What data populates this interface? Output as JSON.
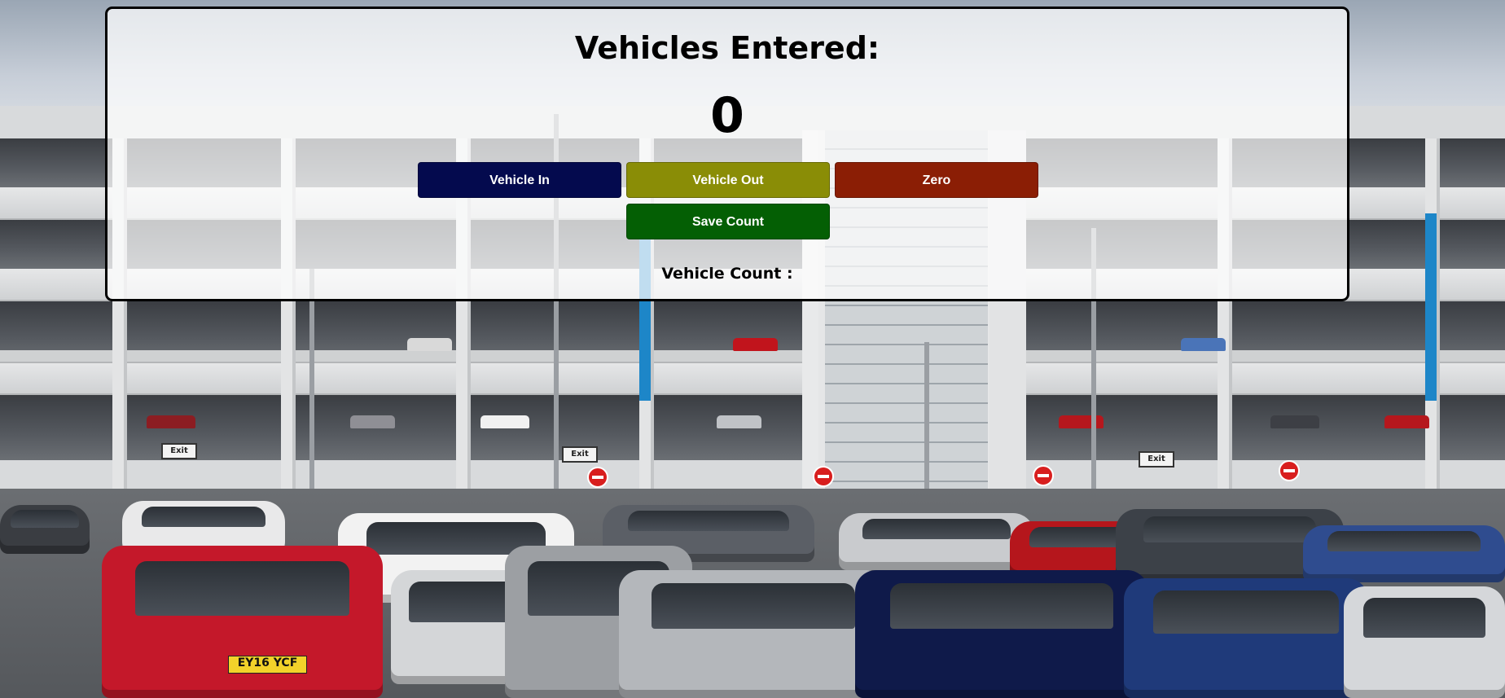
{
  "heading": "Vehicles Entered:",
  "counter": "0",
  "buttons": {
    "vehicle_in": "Vehicle In",
    "vehicle_out": "Vehicle Out",
    "zero": "Zero",
    "save_count": "Save Count"
  },
  "saved_count": {
    "label": "Vehicle Count :",
    "value": ""
  },
  "colors": {
    "vehicle_in": "#040a4e",
    "vehicle_out": "#8a8d06",
    "zero": "#8b1e05",
    "save_count": "#045f04",
    "panel_border": "#000000"
  },
  "background": {
    "plate_left": "EY16 YCF",
    "exit_sign": "Exit"
  }
}
